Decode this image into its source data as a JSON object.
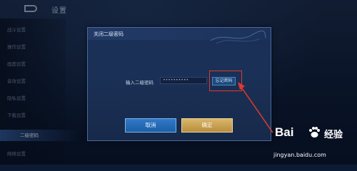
{
  "header": {
    "title": "设置"
  },
  "sidebar": {
    "items": [
      {
        "label": "战斗设置"
      },
      {
        "label": "操作设置"
      },
      {
        "label": "画面设置"
      },
      {
        "label": "音效设置"
      },
      {
        "label": "隐私设置"
      },
      {
        "label": "下载设置"
      },
      {
        "label": "二级密码"
      },
      {
        "label": "网络设置"
      }
    ],
    "active_index": 6
  },
  "dialog": {
    "title": "关闭二级密码",
    "password_label": "输入二级密码",
    "password_value": "••••••••••",
    "forgot_label": "忘记密码",
    "cancel_label": "取消",
    "ok_label": "确定"
  },
  "watermark": {
    "logo_text": "Bai",
    "cn_text": "经验",
    "url": "jingyan.baidu.com"
  },
  "colors": {
    "highlight": "#e0392f",
    "cancel": "#2f79c8",
    "ok": "#d9b56a"
  },
  "icons": [
    "back-icon",
    "swirl-decoration-icon",
    "baidu-paw-icon"
  ]
}
